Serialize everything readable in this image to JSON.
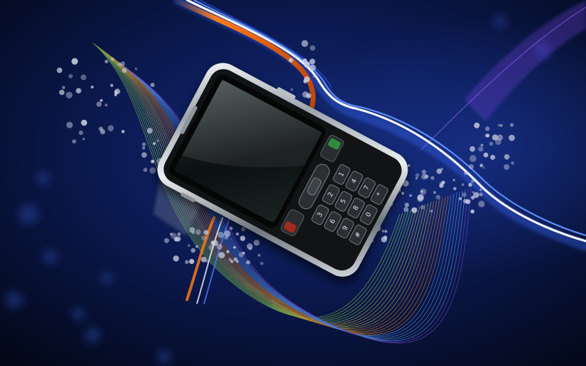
{
  "image": {
    "subject": "smartphone-with-keypad",
    "colors": {
      "background_dark": "#040a22",
      "background_mid": "#0d1d55",
      "accent_orange": "#e06a1a",
      "accent_blue": "#4a7bff",
      "accent_white": "#f2f4ff",
      "mesh_green": "#8fd04a",
      "mesh_violet": "#7a4bd6",
      "phone_body": "#1a1a1a",
      "phone_chrome": "#d8dde2",
      "bokeh": "#c9cde0"
    },
    "keypad_labels": [
      "1",
      "2",
      "3",
      "4",
      "5",
      "6",
      "7",
      "8",
      "9",
      "*",
      "0",
      "#"
    ]
  }
}
